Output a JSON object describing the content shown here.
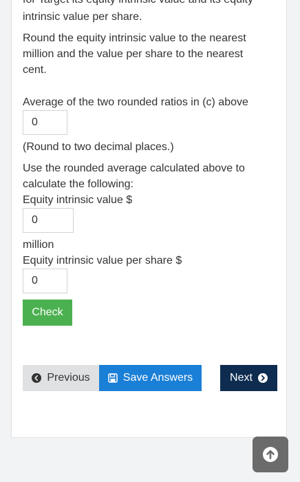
{
  "content": {
    "line_top_cut": "for Target its equity intrinsic value and its equity",
    "line_value_per_share": "intrinsic value per share.",
    "round_line1": "Round the equity intrinsic value to the nearest",
    "round_line2": "million and the value per share to the nearest",
    "round_line3": "cent.",
    "average_label": "Average of the two rounded ratios in (c) above",
    "average_value": "0",
    "round_two_decimals": "(Round to two decimal places.)",
    "use_line1": "Use the rounded average calculated above to",
    "use_line2": "calculate the following:",
    "equity_label": "Equity intrinsic value $",
    "equity_value": "0",
    "million": "million",
    "per_share_label": "Equity intrinsic value per share $",
    "per_share_value": "0",
    "check_label": "Check"
  },
  "nav": {
    "previous_label": "Previous",
    "save_label": "Save Answers",
    "next_label": "Next"
  },
  "icons": {
    "previous": "chevron-left-circle-icon",
    "save": "floppy-disk-icon",
    "next": "chevron-right-circle-icon",
    "scroll_top": "arrow-up-circle-icon"
  },
  "colors": {
    "check": "#4bb04f",
    "save": "#1a7fd6",
    "next": "#0d2c4f",
    "previous": "#e0e1e3"
  }
}
